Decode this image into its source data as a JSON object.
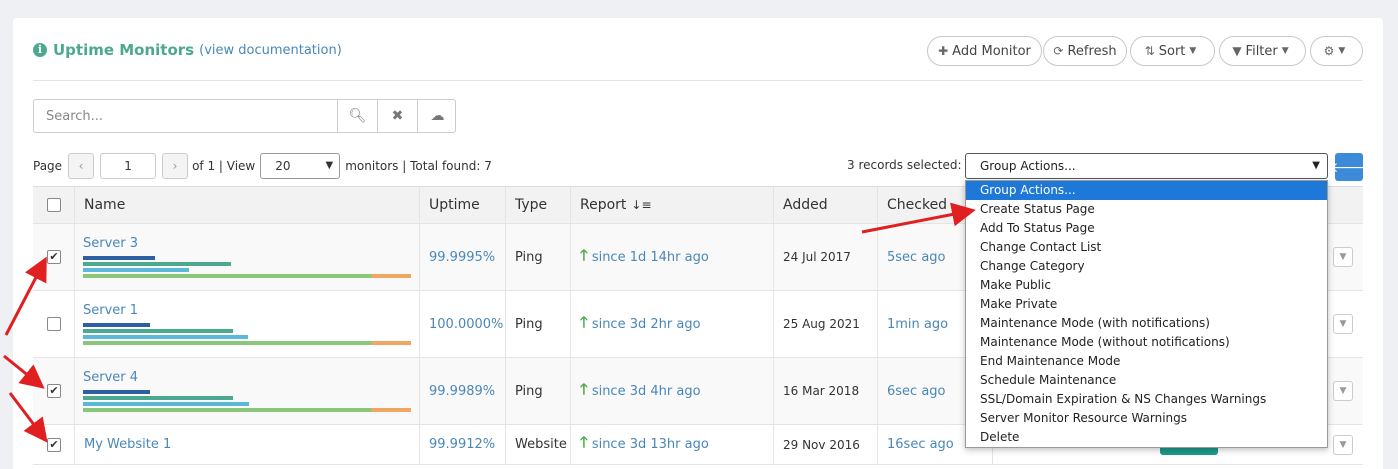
{
  "header": {
    "title": "Uptime Monitors",
    "doc_link_prefix": "(",
    "doc_link": "view documentation",
    "doc_link_suffix": ")",
    "buttons": {
      "add": "Add Monitor",
      "refresh": "Refresh",
      "sort": "Sort",
      "filter": "Filter"
    }
  },
  "search": {
    "placeholder": "Search..."
  },
  "pager": {
    "page_label": "Page",
    "page_value": "1",
    "of_text": "of 1 | View",
    "per_page": "20",
    "summary": "monitors | Total found: 7"
  },
  "group_actions": {
    "selected_text": "3 records selected:",
    "selected_value": "Group Actions...",
    "options": [
      "Group Actions...",
      "Create Status Page",
      "Add To Status Page",
      "Change Contact List",
      "Change Category",
      "Make Public",
      "Make Private",
      "Maintenance Mode (with notifications)",
      "Maintenance Mode (without notifications)",
      "End Maintenance Mode",
      "Schedule Maintenance",
      "SSL/Domain Expiration & NS Changes Warnings",
      "Server Monitor Resource Warnings",
      "Delete"
    ]
  },
  "table": {
    "columns": {
      "name": "Name",
      "uptime": "Uptime",
      "type": "Type",
      "report": "Report",
      "added": "Added",
      "checked": "Checked"
    },
    "rows": [
      {
        "checked": true,
        "name": "Server 3",
        "uptime": "99.9995%",
        "type": "Ping",
        "report": "since 1d 14hr ago",
        "added": "24 Jul 2017",
        "last_check": "5sec ago"
      },
      {
        "checked": false,
        "name": "Server 1",
        "uptime": "100.0000%",
        "type": "Ping",
        "report": "since 3d 2hr ago",
        "added": "25 Aug 2021",
        "last_check": "1min ago"
      },
      {
        "checked": true,
        "name": "Server 4",
        "uptime": "99.9989%",
        "type": "Ping",
        "report": "since 3d 4hr ago",
        "added": "16 Mar 2018",
        "last_check": "6sec ago"
      },
      {
        "checked": true,
        "name": "My Website 1",
        "uptime": "99.9912%",
        "type": "Website",
        "report": "since 3d 13hr ago",
        "added": "29 Nov 2016",
        "last_check": "16sec ago"
      }
    ]
  },
  "colors": {
    "accent": "#4ca88f",
    "link": "#4a87b8",
    "up": "#4ca84c",
    "highlight": "#1e78d8",
    "annotation": "#e02020"
  }
}
